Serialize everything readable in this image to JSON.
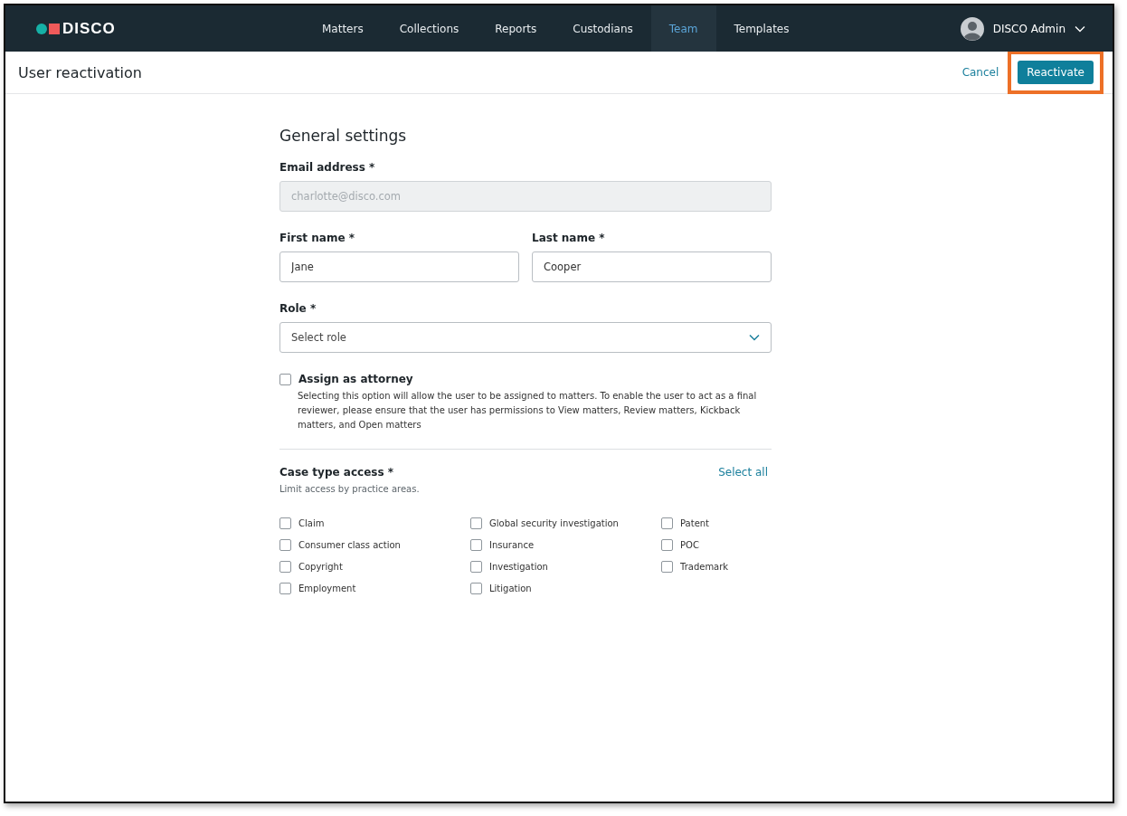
{
  "brand": "DISCO",
  "nav": [
    {
      "label": "Matters",
      "selected": false
    },
    {
      "label": "Collections",
      "selected": false
    },
    {
      "label": "Reports",
      "selected": false
    },
    {
      "label": "Custodians",
      "selected": false
    },
    {
      "label": "Team",
      "selected": true
    },
    {
      "label": "Templates",
      "selected": false
    }
  ],
  "user": {
    "name": "DISCO Admin"
  },
  "header": {
    "title": "User reactivation",
    "cancel": "Cancel",
    "primary": "Reactivate",
    "primary_highlighted": true
  },
  "section_title": "General settings",
  "email": {
    "label": "Email address *",
    "value": "charlotte@disco.com",
    "disabled": true
  },
  "first_name": {
    "label": "First name *",
    "value": "Jane"
  },
  "last_name": {
    "label": "Last name *",
    "value": "Cooper"
  },
  "role": {
    "label": "Role *",
    "placeholder": "Select role"
  },
  "attorney": {
    "label": "Assign as attorney",
    "checked": false,
    "help": "Selecting this option will allow the user to be assigned to matters. To enable the user to act as a final reviewer, please ensure that the user has permissions to View matters, Review matters, Kickback matters, and Open matters"
  },
  "case_access": {
    "title": "Case type access *",
    "select_all": "Select all",
    "hint": "Limit access by practice areas.",
    "options": [
      {
        "label": "Claim",
        "checked": false
      },
      {
        "label": "Consumer class action",
        "checked": false
      },
      {
        "label": "Copyright",
        "checked": false
      },
      {
        "label": "Employment",
        "checked": false
      },
      {
        "label": "Global security investigation",
        "checked": false
      },
      {
        "label": "Insurance",
        "checked": false
      },
      {
        "label": "Investigation",
        "checked": false
      },
      {
        "label": "Litigation",
        "checked": false
      },
      {
        "label": "Patent",
        "checked": false
      },
      {
        "label": "POC",
        "checked": false
      },
      {
        "label": "Trademark",
        "checked": false
      }
    ]
  }
}
